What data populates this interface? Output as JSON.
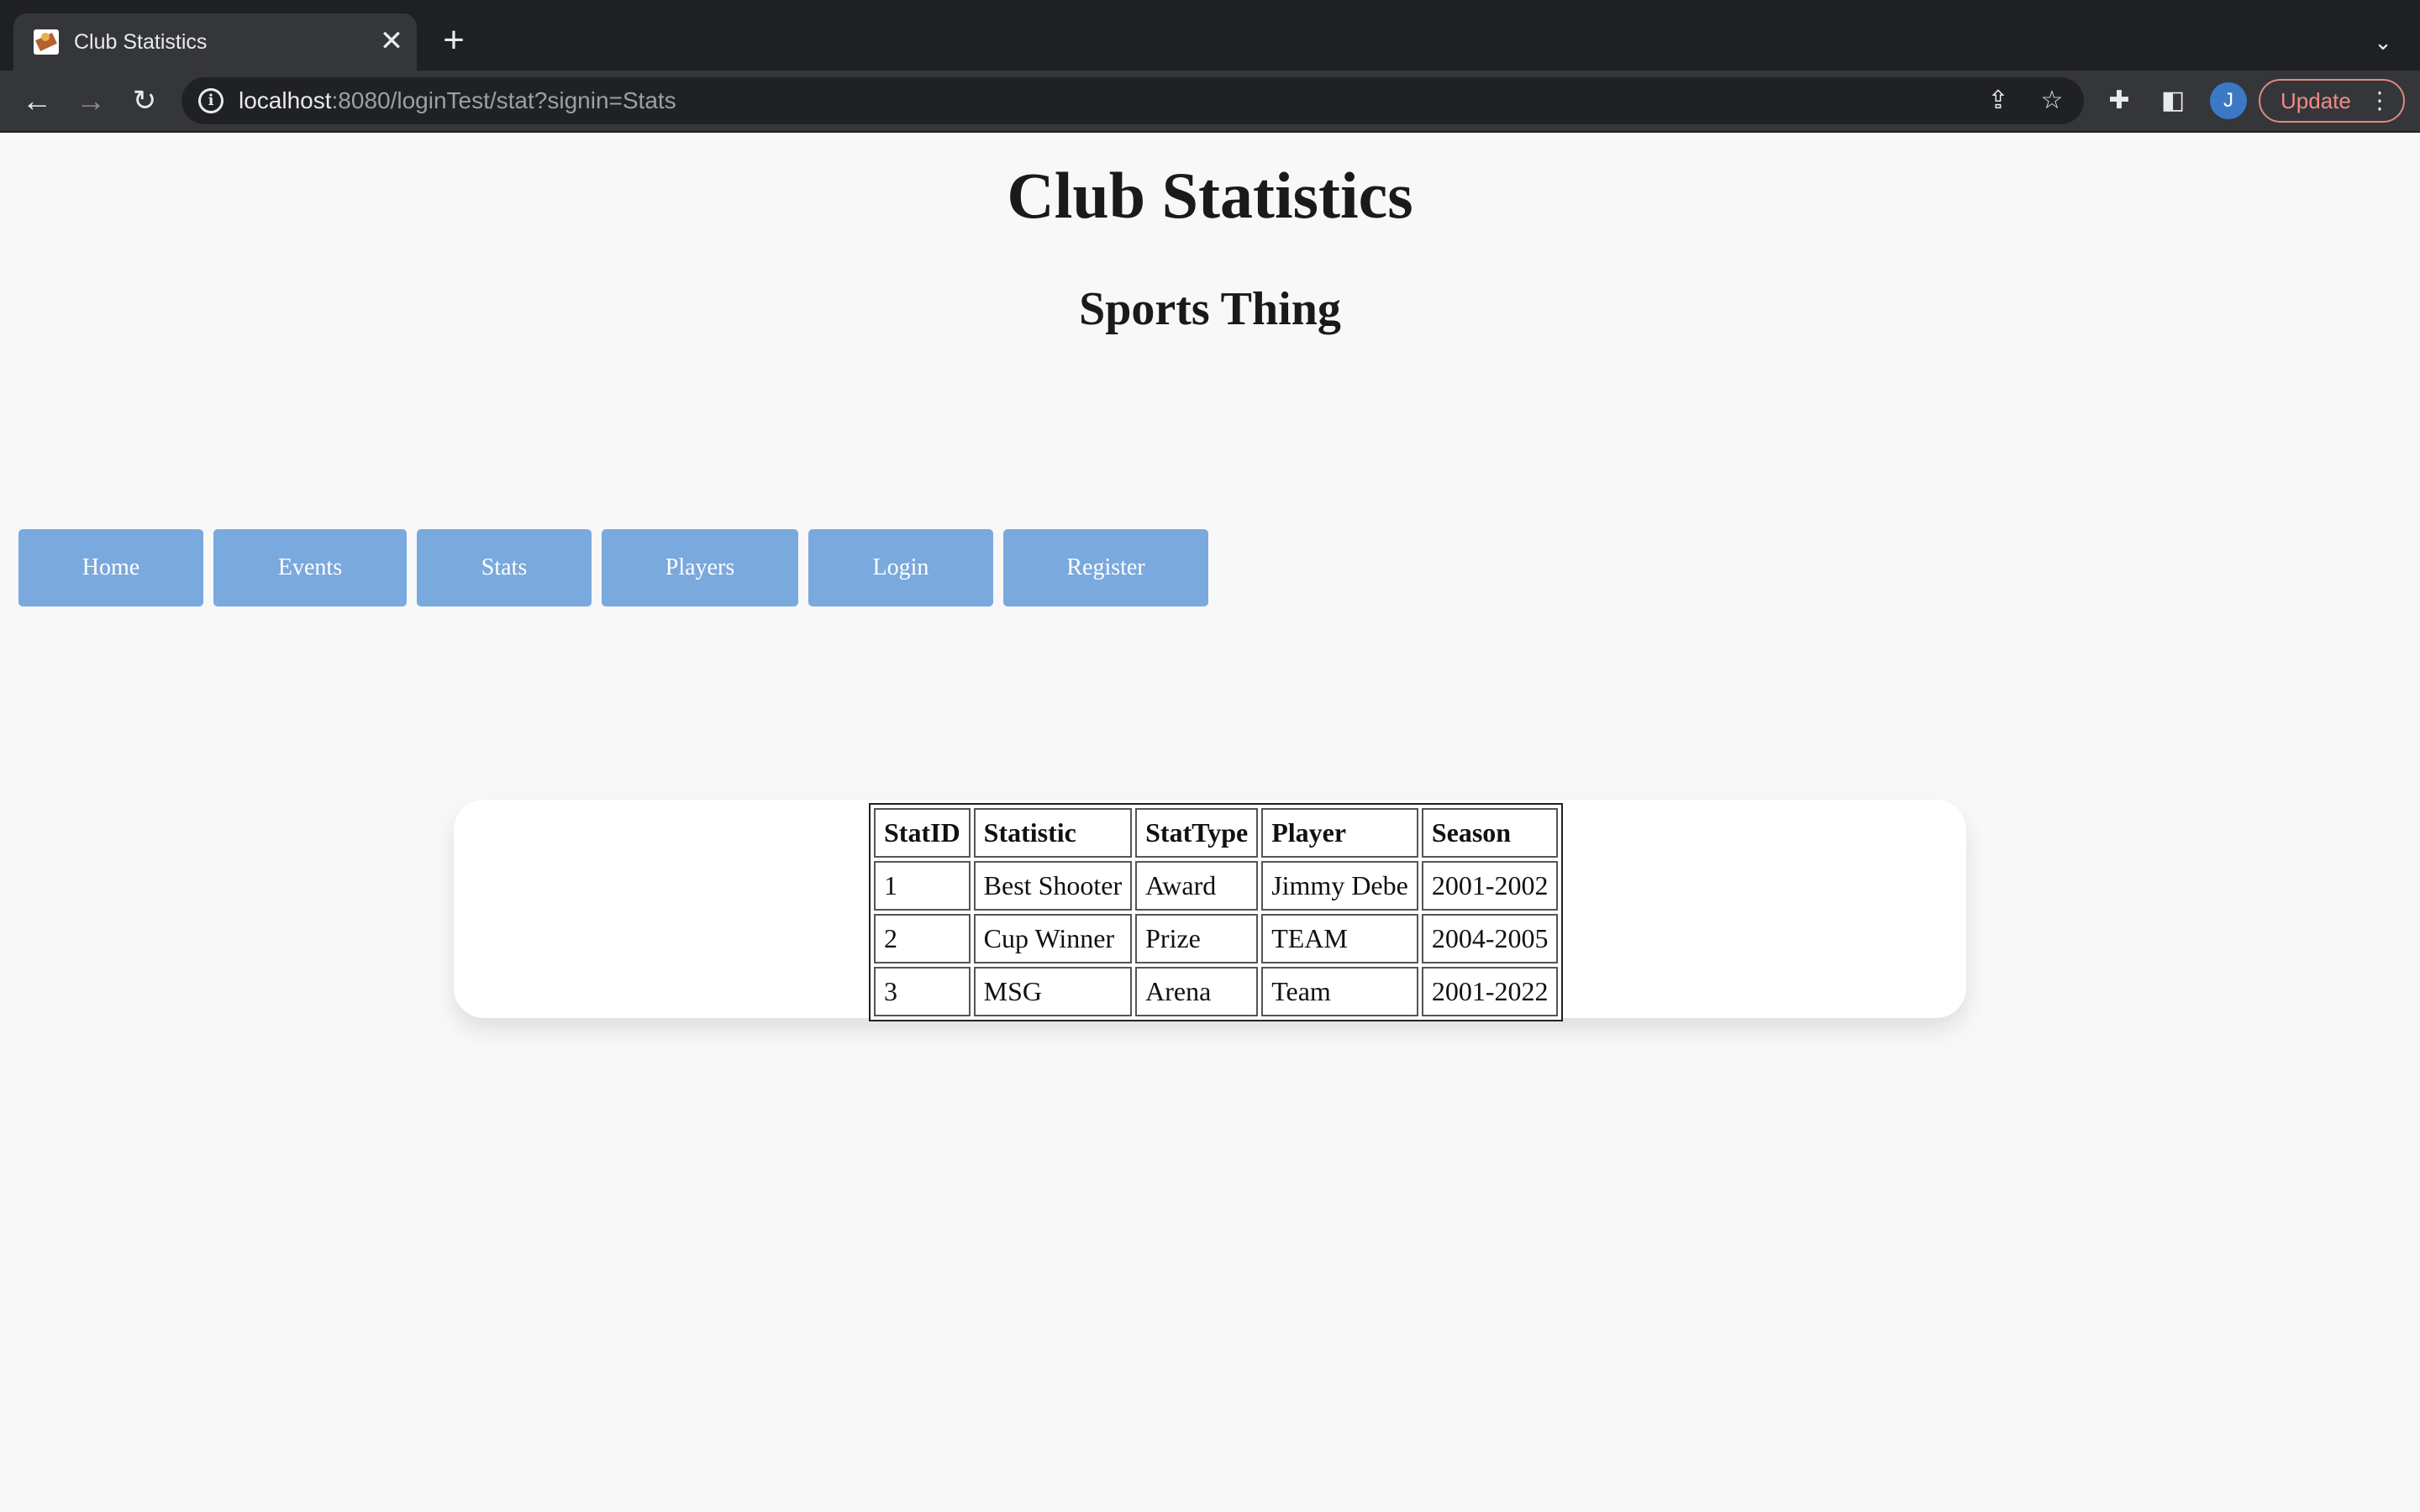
{
  "browser": {
    "tab_title": "Club Statistics",
    "tab_close": "✕",
    "new_tab": "+",
    "url_host": "localhost",
    "url_path": ":8080/loginTest/stat?signin=Stats",
    "profile_initial": "J",
    "update_label": "Update"
  },
  "page": {
    "title": "Club Statistics",
    "subtitle": "Sports Thing"
  },
  "nav": {
    "buttons": [
      "Home",
      "Events",
      "Stats",
      "Players",
      "Login",
      "Register"
    ]
  },
  "table": {
    "headers": [
      "StatID",
      "Statistic",
      "StatType",
      "Player",
      "Season"
    ],
    "rows": [
      [
        "1",
        "Best Shooter",
        "Award",
        "Jimmy Debe",
        "2001-2002"
      ],
      [
        "2",
        "Cup Winner",
        "Prize",
        "TEAM",
        "2004-2005"
      ],
      [
        "3",
        "MSG",
        "Arena",
        "Team",
        "2001-2022"
      ]
    ]
  },
  "colors": {
    "button_bg": "#7aa9de",
    "page_bg": "#f8f8f8",
    "chrome_dark": "#1f2023",
    "update_accent": "#f28b82"
  }
}
